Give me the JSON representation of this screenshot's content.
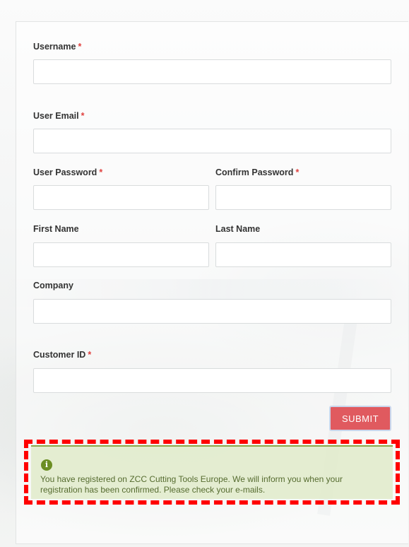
{
  "form": {
    "required_marker": "*",
    "username": {
      "label": "Username",
      "value": ""
    },
    "user_email": {
      "label": "User Email",
      "value": ""
    },
    "user_password": {
      "label": "User Password",
      "value": ""
    },
    "confirm_password": {
      "label": "Confirm Password",
      "value": ""
    },
    "first_name": {
      "label": "First Name",
      "value": ""
    },
    "last_name": {
      "label": "Last Name",
      "value": ""
    },
    "company": {
      "label": "Company",
      "value": ""
    },
    "customer_id": {
      "label": "Customer ID",
      "value": ""
    },
    "submit_label": "SUBMIT"
  },
  "success_message": {
    "icon": "info-icon",
    "text": "You have registered on ZCC Cutting Tools Europe. We will inform you when your registration has been confirmed. Please check your e-mails."
  },
  "colors": {
    "required": "#e0413f",
    "submit_button": "#e05a5f",
    "success_background": "#e2ebcd",
    "success_text": "#556b2f",
    "highlight_border": "#ff0000"
  }
}
